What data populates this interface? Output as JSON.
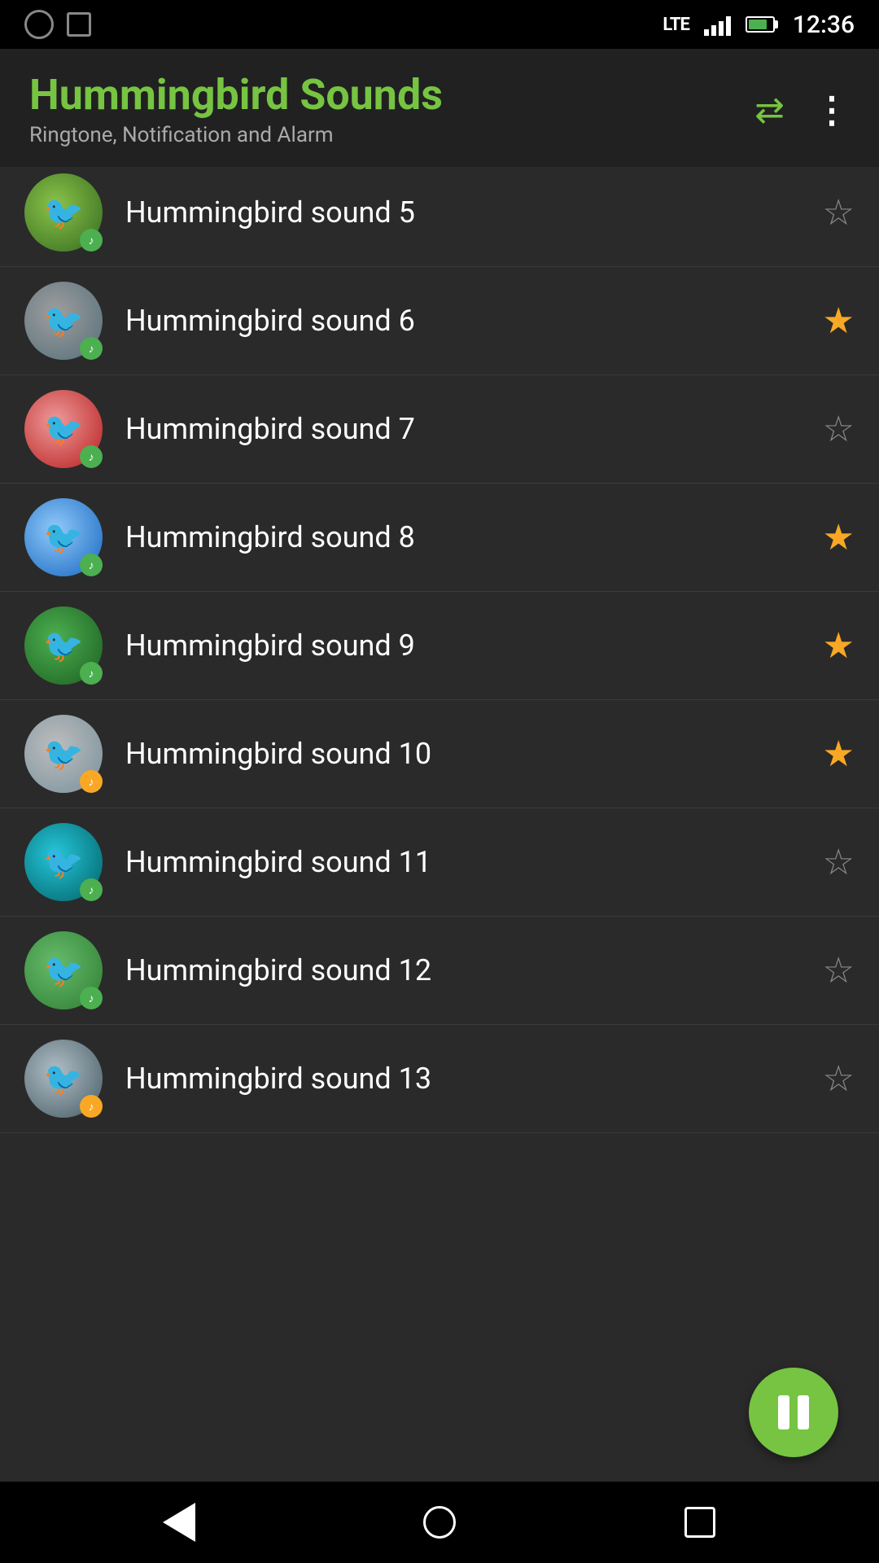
{
  "statusBar": {
    "time": "12:36",
    "network": "LTE"
  },
  "header": {
    "title": "Hummingbird Sounds",
    "subtitle": "Ringtone, Notification and Alarm"
  },
  "sounds": [
    {
      "id": 5,
      "label": "Hummingbird sound 5",
      "favorited": false,
      "thumbClass": "thumb-1",
      "badgeClass": "badge-green",
      "partial": true
    },
    {
      "id": 6,
      "label": "Hummingbird sound 6",
      "favorited": true,
      "thumbClass": "thumb-2",
      "badgeClass": "badge-green"
    },
    {
      "id": 7,
      "label": "Hummingbird sound 7",
      "favorited": false,
      "thumbClass": "thumb-3",
      "badgeClass": "badge-green"
    },
    {
      "id": 8,
      "label": "Hummingbird sound 8",
      "favorited": true,
      "thumbClass": "thumb-4",
      "badgeClass": "badge-green"
    },
    {
      "id": 9,
      "label": "Hummingbird sound 9",
      "favorited": true,
      "thumbClass": "thumb-5",
      "badgeClass": "badge-green"
    },
    {
      "id": 10,
      "label": "Hummingbird sound 10",
      "favorited": true,
      "thumbClass": "thumb-6",
      "badgeClass": "badge-gold"
    },
    {
      "id": 11,
      "label": "Hummingbird sound 11",
      "favorited": false,
      "thumbClass": "thumb-7",
      "badgeClass": "badge-green"
    },
    {
      "id": 12,
      "label": "Hummingbird sound 12",
      "favorited": false,
      "thumbClass": "thumb-8",
      "badgeClass": "badge-green"
    },
    {
      "id": 13,
      "label": "Hummingbird sound 13",
      "favorited": false,
      "thumbClass": "thumb-9",
      "badgeClass": "badge-gold"
    }
  ],
  "fab": {
    "label": "Pause"
  },
  "nav": {
    "back": "Back",
    "home": "Home",
    "recents": "Recents"
  }
}
